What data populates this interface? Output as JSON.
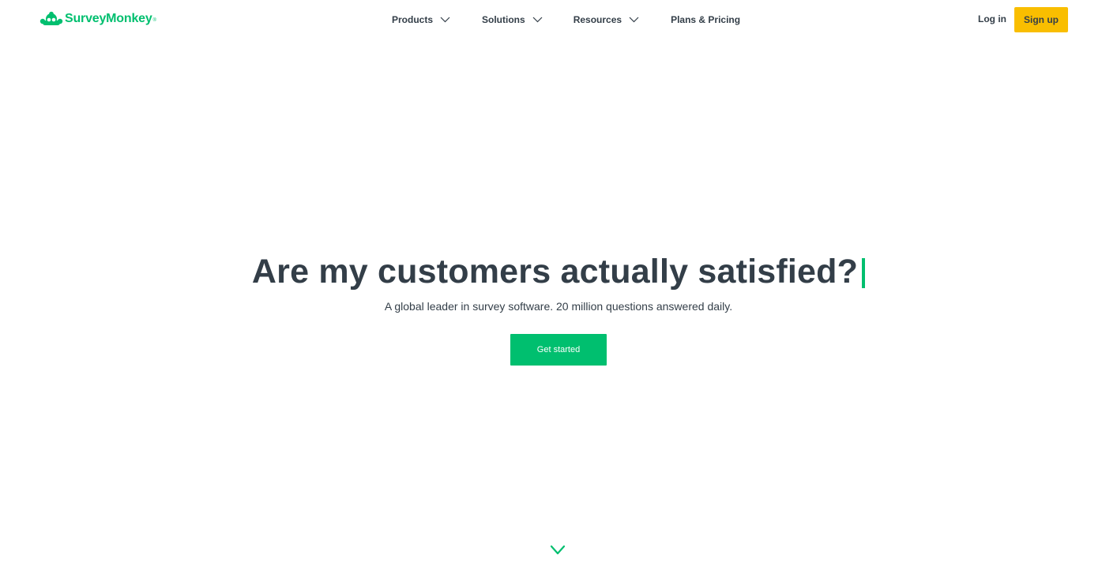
{
  "brand": {
    "name": "SurveyMonkey",
    "trademark": "®",
    "color": "#00bf6f"
  },
  "nav": {
    "items": [
      {
        "label": "Products",
        "has_dropdown": true,
        "icon": "chevron-down-icon"
      },
      {
        "label": "Solutions",
        "has_dropdown": true,
        "icon": "chevron-down-icon"
      },
      {
        "label": "Resources",
        "has_dropdown": true,
        "icon": "chevron-down-icon"
      },
      {
        "label": "Plans & Pricing",
        "has_dropdown": false
      }
    ],
    "login_label": "Log in",
    "signup_label": "Sign up",
    "signup_color": "#f9be00"
  },
  "hero": {
    "headline": "Are my customers actually satisfied?",
    "subheadline": "A global leader in survey software. 20 million questions answered daily.",
    "cta_label": "Get started",
    "cta_color": "#00bf6f"
  },
  "scroll_indicator": {
    "icon": "chevron-down-icon",
    "color": "#00bf6f"
  },
  "colors": {
    "text": "#333e48",
    "background": "#ffffff"
  }
}
